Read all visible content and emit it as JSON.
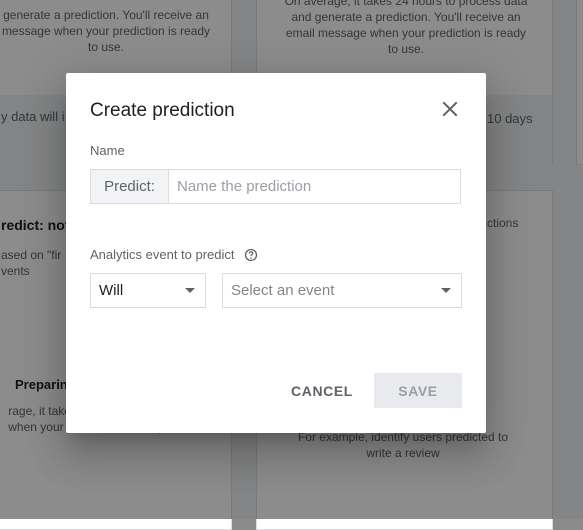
{
  "background": {
    "card_top_left": {
      "text": "generate a prediction. You'll receive an message when your prediction is ready to use.",
      "footer": "y data will i ctions"
    },
    "card_top_middle": {
      "text": "On average, it takes 24 hours to process data and generate a prediction. You'll receive an email message when your prediction is ready to use.",
      "footer": "10 days"
    },
    "card_bottom_left": {
      "title": "redict: not_",
      "line1": "ased on \"fir",
      "line2": "vents",
      "status": "Preparin",
      "text": "rage, it takes enerate a pre message when your prediction is ready to use."
    },
    "card_bottom_right": {
      "line": "ctions",
      "text": "For example, identify users predicted to write a review"
    }
  },
  "dialog": {
    "title": "Create prediction",
    "name_label": "Name",
    "prefix": "Predict:",
    "name_placeholder": "Name the prediction",
    "event_label": "Analytics event to predict",
    "will_value": "Will",
    "event_placeholder": "Select an event",
    "cancel": "CANCEL",
    "save": "SAVE"
  },
  "colors": {
    "scrim": "#00000073",
    "text_primary": "#202124",
    "text_secondary": "#5f6368",
    "disabled_bg": "#f1f3f4"
  }
}
